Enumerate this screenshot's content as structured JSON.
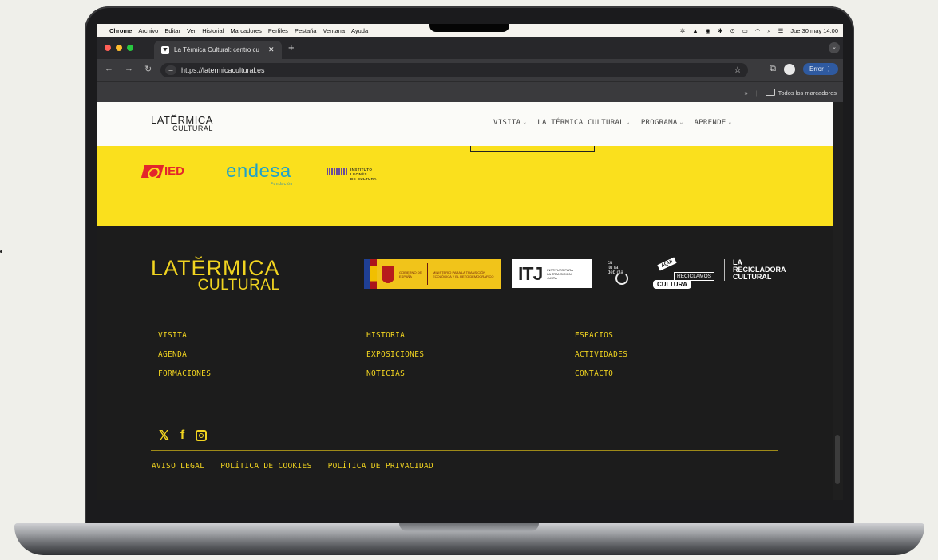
{
  "menubar": {
    "app": "Chrome",
    "items": [
      "Archivo",
      "Editar",
      "Ver",
      "Historial",
      "Marcadores",
      "Perfiles",
      "Pestaña",
      "Ventana",
      "Ayuda"
    ],
    "clock": "Jue 30 may 14:00"
  },
  "browser": {
    "tab_title": "La Térmica Cultural: centro cu",
    "url": "https://latermicacultural.es",
    "error_label": "Error",
    "bookmarks_label": "Todos los marcadores",
    "more": "»"
  },
  "site": {
    "logo_line1": "LATĔRMICA",
    "logo_line2": "CULTURAL",
    "nav": [
      "VISITA",
      "LA TÉRMICA CULTURAL",
      "PROGRAMA",
      "APRENDE"
    ]
  },
  "sponsors": {
    "ied": "IED",
    "endesa": "endesa",
    "endesa_sub": "Fundación",
    "ilc_lines": [
      "INSTITUTO",
      "LEONÉS",
      "DE CULTURA"
    ]
  },
  "footer": {
    "logo_line1": "LATĔRMICA",
    "logo_line2": "CULTURAL",
    "gobierno": "GOBIERNO DE ESPAÑA",
    "ministerio": "MINISTERIO PARA LA TRANSICIÓN ECOLÓGICA Y EL RETO DEMOGRÁFICO",
    "itj": "ITJ",
    "itj_text": "INSTITUTO PARA LA TRANSICIÓN JUSTA",
    "cultura_lines": [
      "cu",
      "ltu ra",
      "deb gla"
    ],
    "aqui": "AQUÍ",
    "reciclamos": "RECICLAMOS",
    "cultura": "CULTURA",
    "recicladora_lines": [
      "LA",
      "RECICLADORA",
      "CULTURAL"
    ],
    "columns": [
      [
        "VISITA",
        "AGENDA",
        "FORMACIONES"
      ],
      [
        "HISTORIA",
        "EXPOSICIONES",
        "NOTICIAS"
      ],
      [
        "ESPACIOS",
        "ACTIVIDADES",
        "CONTACTO"
      ]
    ],
    "legal": [
      "AVISO LEGAL",
      "POLÍTICA DE COOKIES",
      "POLÍTICA DE PRIVACIDAD"
    ]
  },
  "colors": {
    "yellow": "#fae01d",
    "footer_bg": "#1c1c1c",
    "footer_text": "#f1d420",
    "endesa_blue": "#1ea1c9",
    "ied_red": "#e3262b"
  }
}
